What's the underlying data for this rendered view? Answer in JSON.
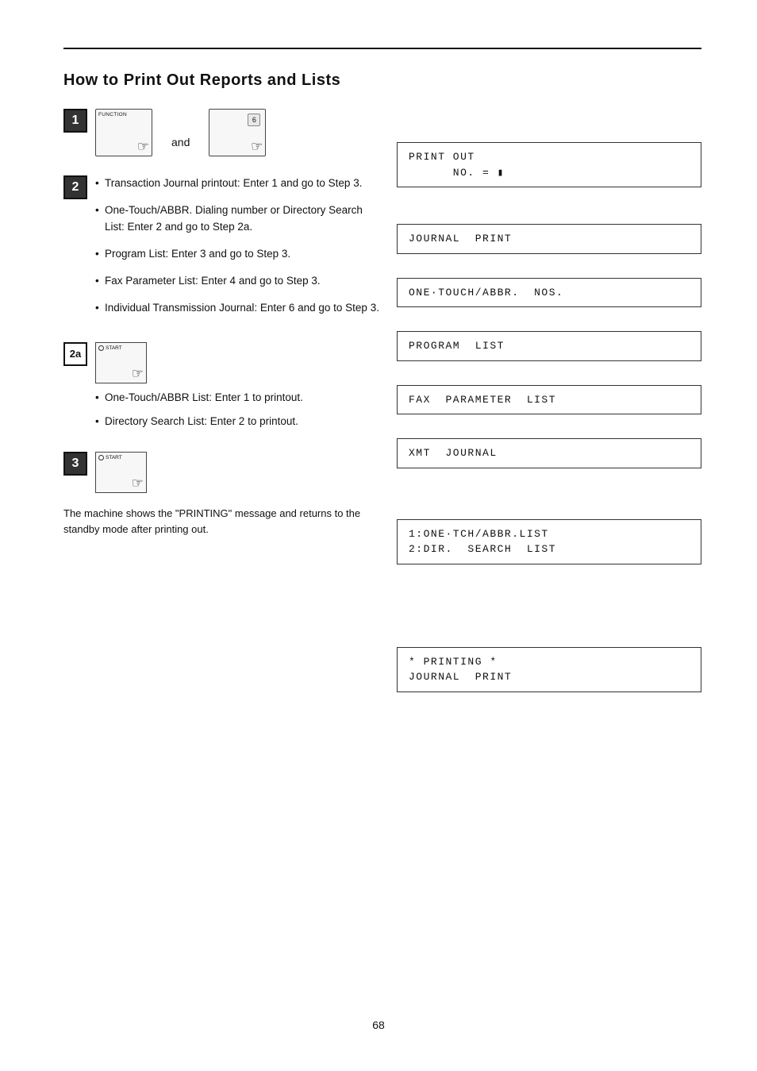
{
  "page": {
    "title": "How to Print Out Reports and Lists",
    "page_number": "68",
    "top_rule": true
  },
  "steps": {
    "step1": {
      "number": "1",
      "label1": "FUNCTION",
      "label2": "6",
      "and_text": "and"
    },
    "step2": {
      "number": "2",
      "bullets": [
        "Transaction Journal printout: Enter 1 and go to Step 3.",
        "One-Touch/ABBR.  Dialing  number  or Directory Search List:\nEnter 2 and go to Step 2a.",
        "Program List: Enter 3 and go to Step 3.",
        "Fax Parameter List: Enter 4 and go to Step 3.",
        "Individual Transmission Journal: Enter 6 and go to Step 3."
      ]
    },
    "step2a": {
      "label": "2a",
      "start_label": "START",
      "bullets": [
        "One-Touch/ABBR List: Enter 1 to printout.",
        "Directory Search List: Enter 2 to printout."
      ]
    },
    "step3": {
      "number": "3",
      "start_label": "START",
      "final_note": "The machine shows the \"PRINTING\" message and returns to the standby mode after printing out."
    }
  },
  "display_boxes": {
    "box1": "PRINT OUT\n      NO. = ▮",
    "box2": "JOURNAL  PRINT",
    "box3": "ONE·TOUCH/ABBR.  NOS.",
    "box4": "PROGRAM  LIST",
    "box5": "FAX  PARAMETER  LIST",
    "box6": "XMT  JOURNAL",
    "box7": "1:ONE·TCH/ABBR.LIST\n2:DIR.  SEARCH  LIST",
    "box8": "* PRINTING *\nJOURNAL  PRINT"
  }
}
